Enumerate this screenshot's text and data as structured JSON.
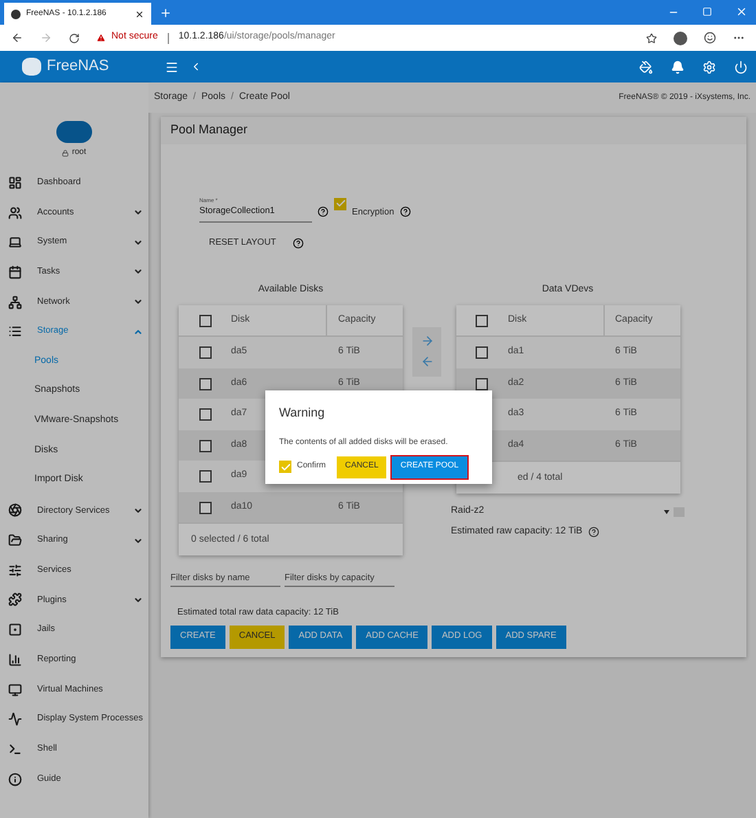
{
  "browser": {
    "tab_title": "FreeNAS - 10.1.2.186",
    "security": "Not secure",
    "url_host": "10.1.2.186",
    "url_path": "/ui/storage/pools/manager"
  },
  "header": {
    "brand": "FreeNAS"
  },
  "sidebar": {
    "user": "root",
    "items": [
      {
        "label": "Dashboard",
        "selected": false
      },
      {
        "label": "Accounts",
        "selected": false,
        "expanded": false
      },
      {
        "label": "System",
        "selected": false,
        "expanded": false
      },
      {
        "label": "Tasks",
        "selected": false,
        "expanded": false
      },
      {
        "label": "Network",
        "selected": false,
        "expanded": false
      },
      {
        "label": "Storage",
        "selected": true,
        "expanded": true,
        "children": [
          {
            "label": "Pools",
            "selected": true
          },
          {
            "label": "Snapshots",
            "selected": false
          },
          {
            "label": "VMware-Snapshots",
            "selected": false
          },
          {
            "label": "Disks",
            "selected": false
          },
          {
            "label": "Import Disk",
            "selected": false
          }
        ]
      },
      {
        "label": "Directory Services",
        "selected": false,
        "expanded": false
      },
      {
        "label": "Sharing",
        "selected": false,
        "expanded": false
      },
      {
        "label": "Services",
        "selected": false
      },
      {
        "label": "Plugins",
        "selected": false,
        "expanded": false
      },
      {
        "label": "Jails",
        "selected": false
      },
      {
        "label": "Reporting",
        "selected": false
      },
      {
        "label": "Virtual Machines",
        "selected": false
      },
      {
        "label": "Display System Processes",
        "selected": false
      },
      {
        "label": "Shell",
        "selected": false
      },
      {
        "label": "Guide",
        "selected": false
      }
    ]
  },
  "breadcrumb": {
    "separator": "/",
    "items": [
      "Storage",
      "Pools",
      "Create Pool"
    ]
  },
  "copyright": "FreeNAS® © 2019 - iXsystems, Inc.",
  "pool_manager": {
    "title": "Pool Manager",
    "name_label": "Name *",
    "name_value": "StorageCollection1",
    "encryption": {
      "label": "Encryption",
      "checked": true
    },
    "reset_layout": "RESET LAYOUT",
    "available_disks": {
      "title": "Available Disks",
      "all_checked": false,
      "columns": [
        "Disk",
        "Capacity"
      ],
      "rows": [
        {
          "disk": "da5",
          "capacity": "6 TiB",
          "checked": false
        },
        {
          "disk": "da6",
          "capacity": "6 TiB",
          "checked": false
        },
        {
          "disk": "da7",
          "checked": false
        },
        {
          "disk": "da8",
          "checked": false
        },
        {
          "disk": "da9",
          "checked": false
        },
        {
          "disk": "da10",
          "capacity": "6 TiB",
          "checked": false
        }
      ],
      "footer": "0 selected / 6 total"
    },
    "data_vdevs": {
      "title": "Data VDevs",
      "all_checked": false,
      "columns": [
        "Disk",
        "Capacity"
      ],
      "rows": [
        {
          "disk": "da1",
          "capacity": "6 TiB",
          "checked": false
        },
        {
          "disk": "da2",
          "capacity": "6 TiB",
          "checked": false
        },
        {
          "disk": "da3",
          "capacity": "6 TiB"
        },
        {
          "disk": "da4",
          "capacity": "6 TiB"
        }
      ],
      "footer": "ed / 4 total",
      "layout": "Raid-z2",
      "estimated": "Estimated raw capacity: 12 TiB"
    },
    "filter_name": {
      "placeholder": "Filter disks by name"
    },
    "filter_capacity": {
      "placeholder": "Filter disks by capacity"
    },
    "total": "Estimated total raw data capacity: 12 TiB",
    "buttons": [
      {
        "label": "CREATE",
        "kind": "primary"
      },
      {
        "label": "CANCEL",
        "kind": "warn"
      },
      {
        "label": "ADD DATA",
        "kind": "primary"
      },
      {
        "label": "ADD CACHE",
        "kind": "primary"
      },
      {
        "label": "ADD LOG",
        "kind": "primary"
      },
      {
        "label": "ADD SPARE",
        "kind": "primary"
      }
    ]
  },
  "dialog": {
    "title": "Warning",
    "message": "The contents of all added disks will be erased.",
    "confirm": {
      "label": "Confirm",
      "checked": true
    },
    "buttons": [
      {
        "label": "CANCEL",
        "kind": "warn",
        "highlighted": false
      },
      {
        "label": "CREATE POOL",
        "kind": "primary",
        "highlighted": true
      }
    ]
  }
}
